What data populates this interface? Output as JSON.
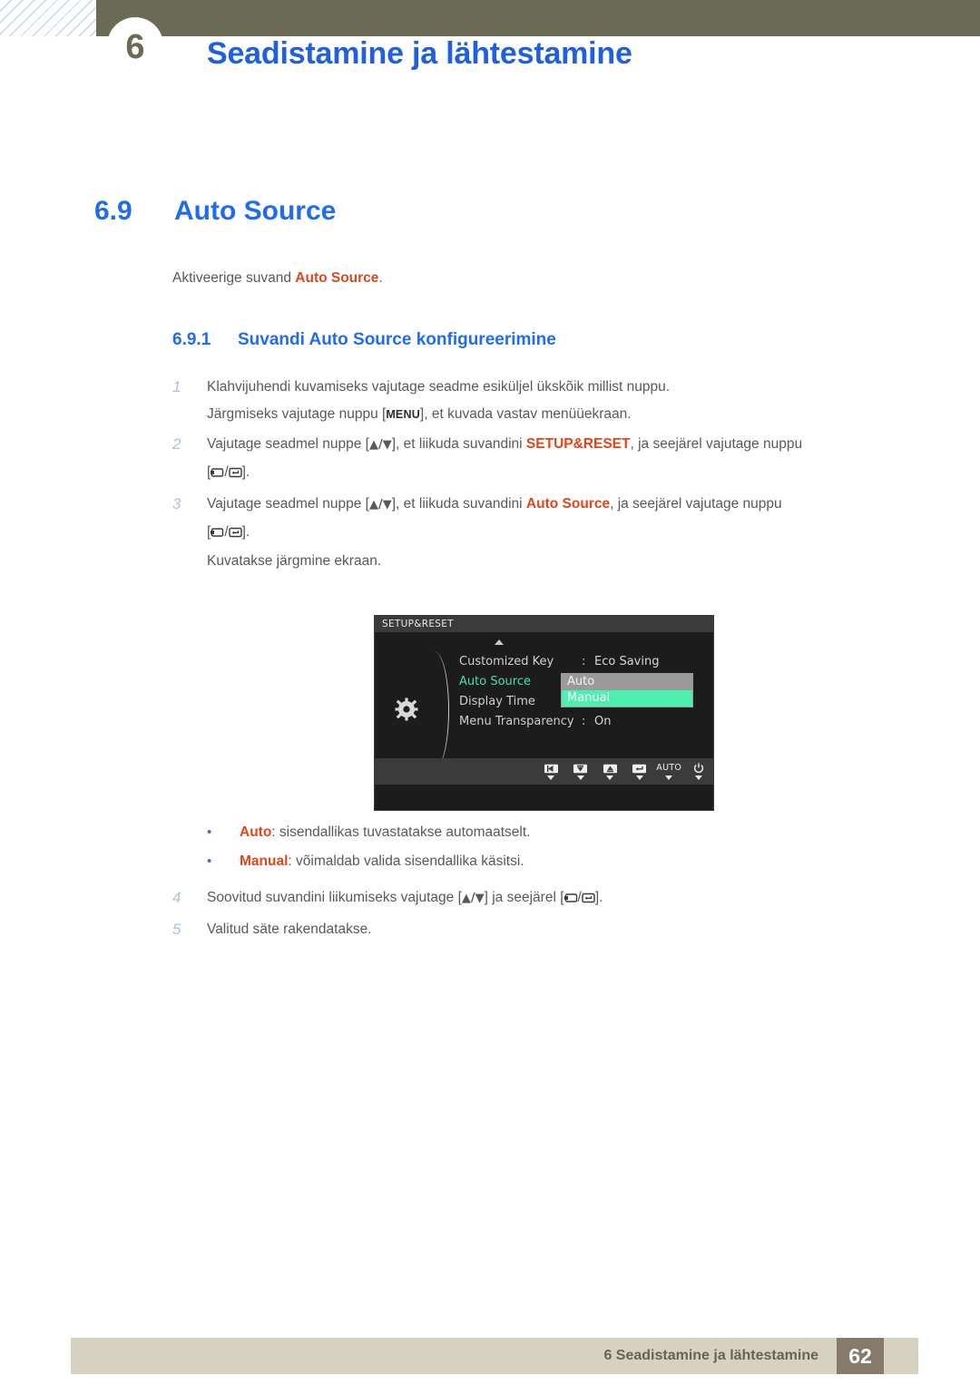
{
  "header": {
    "chapter_number": "6",
    "title": "Seadistamine ja lähtestamine"
  },
  "section": {
    "number": "6.9",
    "title": "Auto Source",
    "intro_prefix": "Aktiveerige suvand ",
    "intro_keyword": "Auto Source",
    "intro_suffix": "."
  },
  "subsection": {
    "number": "6.9.1",
    "title": "Suvandi Auto Source konfigureerimine"
  },
  "steps": [
    {
      "num": "1",
      "line1": "Klahvijuhendi kuvamiseks vajutage seadme esiküljel ükskõik millist nuppu.",
      "line2_a": "Järgmiseks vajutage nuppu [",
      "line2_menu": "MENU",
      "line2_b": "], et kuvada vastav menüüekraan."
    },
    {
      "num": "2",
      "a": "Vajutage seadmel nuppe [",
      "arrows": "▲/▼",
      "b": "], et liikuda suvandini ",
      "keyword": "SETUP&RESET",
      "c": ", ja seejärel vajutage nuppu",
      "d": "["
    },
    {
      "num": "3",
      "a": "Vajutage seadmel nuppe [",
      "arrows": "▲/▼",
      "b": "], et liikuda suvandini ",
      "keyword": "Auto Source",
      "c": ", ja seejärel vajutage nuppu",
      "d": "[",
      "extra": "Kuvatakse järgmine ekraan."
    }
  ],
  "bracket_close": "].",
  "osd": {
    "title": "SETUP&RESET",
    "rows": [
      {
        "label": "Customized Key",
        "colon": ":",
        "value": "Eco Saving",
        "active": false
      },
      {
        "label": "Auto Source",
        "colon": ":",
        "value": "",
        "active": true
      },
      {
        "label": "Display Time",
        "colon": ":",
        "value": "",
        "active": false
      },
      {
        "label": "Menu Transparency",
        "colon": ":",
        "value": "On",
        "active": false
      }
    ],
    "dropdown": {
      "options": [
        "Auto",
        "Manual"
      ],
      "selected": "Manual"
    },
    "footer_buttons": [
      {
        "icon": "left-arrow-icon",
        "label": ""
      },
      {
        "icon": "down-arrow-icon",
        "label": ""
      },
      {
        "icon": "up-arrow-icon",
        "label": ""
      },
      {
        "icon": "enter-icon",
        "label": ""
      },
      {
        "icon": "auto-icon",
        "label": "AUTO"
      },
      {
        "icon": "power-icon",
        "label": ""
      }
    ],
    "gear_icon": "gear-icon",
    "scroll_up_icon": "scroll-up-arrow-icon",
    "colors": {
      "background": "#1c1c1c",
      "title_bar": "#3b3b3b",
      "highlight_green": "#4ef0b0",
      "active_text": "#49e0a0",
      "dropdown_bg": "#9a9a9a"
    }
  },
  "bullets": [
    {
      "keyword": "Auto",
      "text": ": sisendallikas tuvastatakse automaatselt."
    },
    {
      "keyword": "Manual",
      "text": ": võimaldab valida sisendallika käsitsi."
    }
  ],
  "steps_after": [
    {
      "num": "4",
      "a": "Soovitud suvandini liikumiseks vajutage [",
      "arrows": "▲/▼",
      "b": "] ja seejärel [",
      "c": "]."
    },
    {
      "num": "5",
      "a": "Valitud säte rakendatakse."
    }
  ],
  "footer": {
    "text": "6 Seadistamine ja lähtestamine",
    "page": "62"
  },
  "colors": {
    "header_olive": "#6b6a55",
    "heading_blue": "#1f6ded",
    "keyword_orange": "#e0461a",
    "body_gray": "#58595b",
    "step_num_blue": "#a9c0ea",
    "footer_bar": "#d6d1c0",
    "page_badge": "#857a6c"
  }
}
